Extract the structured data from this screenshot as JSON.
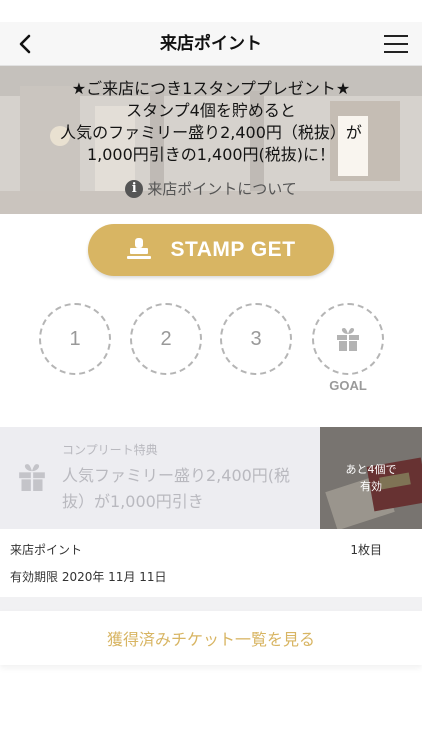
{
  "header": {
    "title": "来店ポイント"
  },
  "banner": {
    "lines": [
      "★ご来店につき1スタンププレゼント★",
      "スタンプ4個を貯めると",
      "人気のファミリー盛り2,400円（税抜）が",
      "1,000円引きの1,400円(税抜)に！"
    ],
    "about_link": "来店ポイントについて"
  },
  "stamp_button": {
    "label": "STAMP GET",
    "color": "#d8b563"
  },
  "stamp_slots": [
    "1",
    "2",
    "3"
  ],
  "goal_label": "GOAL",
  "reward": {
    "caption": "コンプリート特典",
    "description": "人気ファミリー盛り2,400円(税抜）が1,000円引き",
    "remaining": [
      "あと4個で",
      "有効"
    ]
  },
  "card_info": {
    "name": "来店ポイント",
    "count": "1枚目",
    "expiry": "有効期限 2020年 11月 11日"
  },
  "ticket_list_link": "獲得済みチケット一覧を見る",
  "colors": {
    "accent": "#d8b563",
    "muted": "#b9b9bf"
  }
}
